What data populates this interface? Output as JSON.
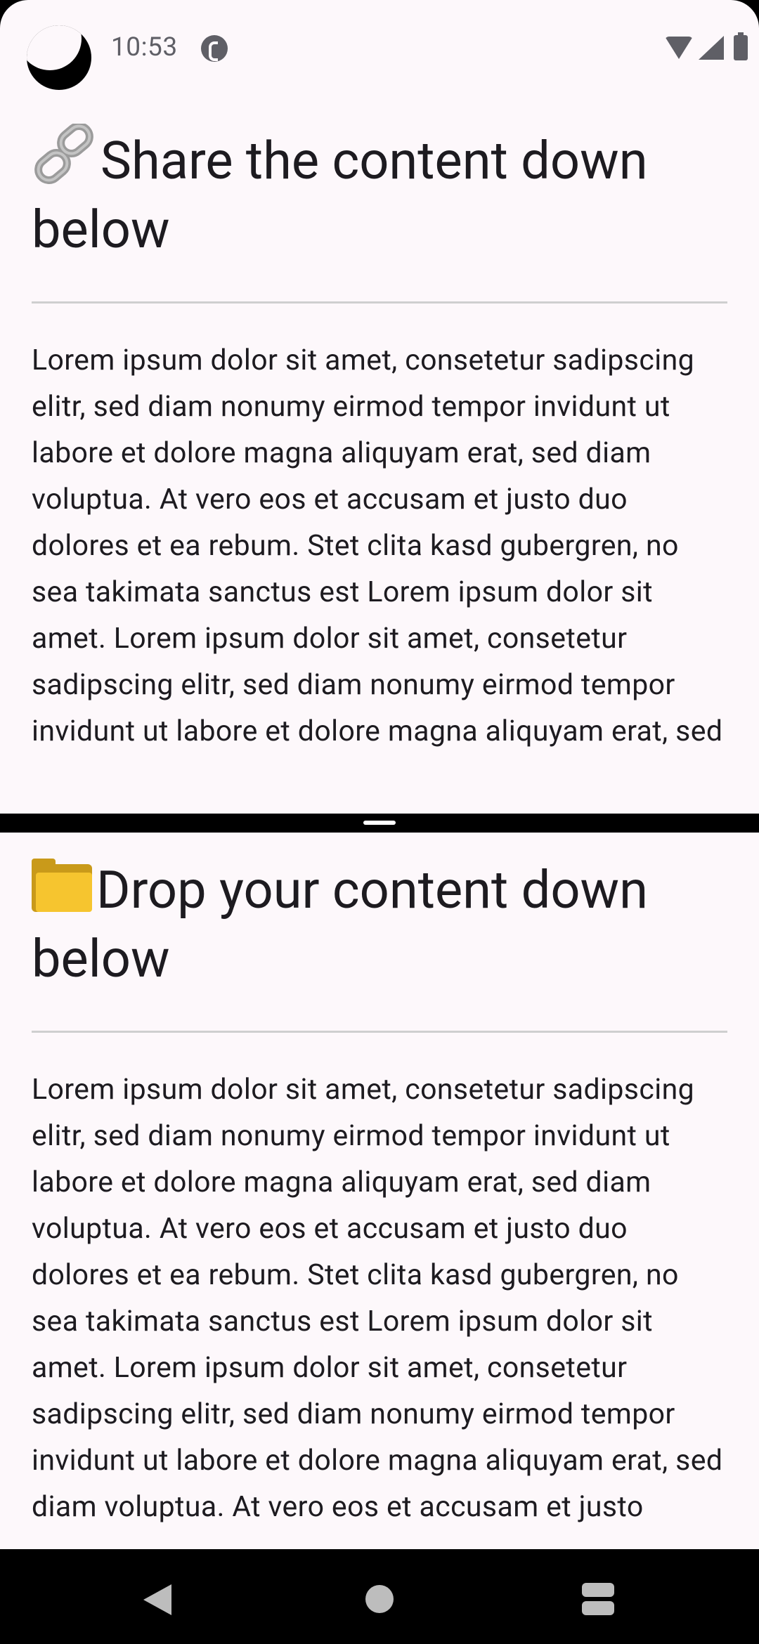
{
  "status_bar": {
    "time": "10:53"
  },
  "top_pane": {
    "title_icon": "link-emoji",
    "title": "Share the content down below",
    "body": "Lorem ipsum dolor sit amet, consetetur sadipscing elitr, sed diam nonumy eirmod tempor invidunt ut labore et dolore magna aliquyam erat, sed diam voluptua. At vero eos et accusam et justo duo dolores et ea rebum. Stet clita kasd gubergren, no sea takimata sanctus est Lorem ipsum dolor sit amet. Lorem ipsum dolor sit amet, consetetur sadipscing elitr, sed diam nonumy eirmod tempor invidunt ut labore et dolore magna aliquyam erat, sed"
  },
  "bottom_pane": {
    "title_icon": "folder-emoji",
    "title": "Drop your content down below",
    "body": "Lorem ipsum dolor sit amet, consetetur sadipscing elitr, sed diam nonumy eirmod tempor invidunt ut labore et dolore magna aliquyam erat, sed diam voluptua. At vero eos et accusam et justo duo dolores et ea rebum. Stet clita kasd gubergren, no sea takimata sanctus est Lorem ipsum dolor sit amet. Lorem ipsum dolor sit amet, consetetur sadipscing elitr, sed diam nonumy eirmod tempor invidunt ut labore et dolore magna aliquyam erat, sed diam voluptua. At vero eos et accusam et justo"
  },
  "navigation": {
    "back": "back-icon",
    "home": "home-icon",
    "recents": "recents-icon"
  }
}
